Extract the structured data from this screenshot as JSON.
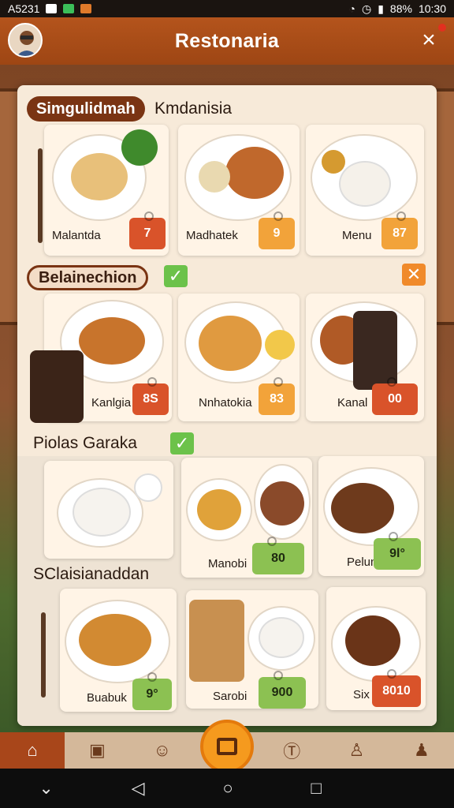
{
  "status_bar": {
    "time_left": "A5231",
    "battery": "88%",
    "time_right": "10:30"
  },
  "header": {
    "title": "Restonaria",
    "close_label": "×"
  },
  "sections": [
    {
      "pill": "Simgulidmah",
      "side_text": "Kmdanisia"
    },
    {
      "pill": "Belainechion"
    },
    {
      "label": "Piolas Garaka"
    },
    {
      "label": "SClaisianaddan"
    }
  ],
  "row1": [
    {
      "name": "Malantda",
      "price": "7"
    },
    {
      "name": "Madhatek",
      "price": "9"
    },
    {
      "name": "Menu",
      "price": "87"
    }
  ],
  "row2": [
    {
      "name": "Kanlgia",
      "price": "8S"
    },
    {
      "name": "Nnhatokia",
      "price": "83"
    },
    {
      "name": "Kanal",
      "price": "00"
    }
  ],
  "row3": [
    {
      "name": "",
      "price": ""
    },
    {
      "name": "Manobi",
      "price": "80"
    },
    {
      "name": "Pelun",
      "price": "9l°"
    }
  ],
  "row4": [
    {
      "name": "Buabuk",
      "price": "9°"
    },
    {
      "name": "Sarobi",
      "price": "900"
    },
    {
      "name": "Six",
      "price": "8010"
    }
  ],
  "icons": {
    "check": "✓",
    "x": "✕",
    "nav": [
      "home-icon",
      "chat-icon",
      "profile-icon",
      "orders-icon",
      "timer-icon",
      "bell-icon",
      "user-icon"
    ]
  },
  "colors": {
    "header": "#b4541c",
    "accent_orange": "#f59a1e",
    "accent_green": "#8cc152",
    "price_red": "#d9532a"
  }
}
